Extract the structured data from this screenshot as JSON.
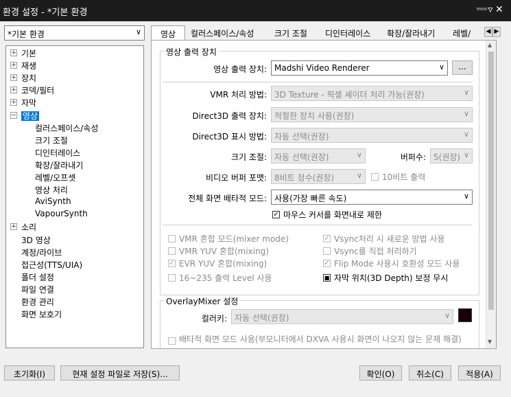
{
  "window": {
    "title": "환경 설정 - *기본 환경",
    "pin_icon": "pin-icon",
    "close_icon": "close-icon"
  },
  "profile_combo": {
    "value": "*기본 환경"
  },
  "tree": [
    {
      "label": "기본",
      "expander": "+"
    },
    {
      "label": "재생",
      "expander": "+"
    },
    {
      "label": "장치",
      "expander": "+"
    },
    {
      "label": "코덱/필터",
      "expander": "+"
    },
    {
      "label": "자막",
      "expander": "+"
    },
    {
      "label": "영상",
      "expander": "−"
    },
    {
      "label": "컬러스페이스/속성"
    },
    {
      "label": "크기 조절"
    },
    {
      "label": "디인터레이스"
    },
    {
      "label": "확장/잘라내기"
    },
    {
      "label": "레벨/오프셋"
    },
    {
      "label": "영상 처리"
    },
    {
      "label": "AviSynth"
    },
    {
      "label": "VapourSynth"
    },
    {
      "label": "소리",
      "expander": "+"
    },
    {
      "label": "3D 영상"
    },
    {
      "label": "계정/라이브"
    },
    {
      "label": "접근성(TTS/UIA)"
    },
    {
      "label": "폴더 설정"
    },
    {
      "label": "파일 연결"
    },
    {
      "label": "환경 관리"
    },
    {
      "label": "화면 보호기"
    }
  ],
  "tabs": [
    "영상",
    "컬러스페이스/속성",
    "크기 조절",
    "디인터레이스",
    "확장/잘라내기",
    "레벨/"
  ],
  "output": {
    "group_title": "영상 출력 장치",
    "device_label": "영상 출력 장치:",
    "device_value": "Madshi Video Renderer",
    "browse_label": "...",
    "vmr_label": "VMR 처리 방법:",
    "vmr_value": "3D Texture - 픽셀 셰이더 처리 가능(권장)",
    "d3d_device_label": "Direct3D 출력 장치:",
    "d3d_device_value": "적절한 장치 사용(권장)",
    "d3d_display_label": "Direct3D 표시 방법:",
    "d3d_display_value": "자동 선택(권장)",
    "resize_label": "크기 조절:",
    "resize_value": "자동 선택(권장)",
    "buffer_label": "버퍼수:",
    "buffer_value": "5(권장)",
    "vbuf_label": "비디오 버퍼 포맷:",
    "vbuf_value": "8비트 정수(권장)",
    "tenbit_label": "10비트 출력",
    "fullscreen_label": "전체 화면 배타적 모드:",
    "fullscreen_value": "사용(가장 빠른 속도)",
    "mouse_label": "마우스 커서를 화면내로 제한"
  },
  "options": {
    "left": [
      {
        "label": "VMR 혼합 모드(mixer mode)",
        "checked": false
      },
      {
        "label": "VMR YUV 혼합(mixing)",
        "checked": false
      },
      {
        "label": "EVR YUV 혼합(mixing)",
        "checked": true
      },
      {
        "label": "16~235 출력 Level 사용",
        "checked": false
      }
    ],
    "right": [
      {
        "label": "Vsync처리 시 새로운 방법 사용",
        "checked": true
      },
      {
        "label": "Vsync를 직접 처리하기",
        "checked": false
      },
      {
        "label": "Flip Mode 사용시 호환성 모드 사용",
        "checked": true
      },
      {
        "label": "자막 위치(3D Depth) 보정 무시",
        "checked": true
      }
    ]
  },
  "overlay": {
    "group_title": "OverlayMixer 설정",
    "colorkey_label": "컬러키:",
    "colorkey_value": "자동 선택(권장)",
    "colorkey_swatch": "#1a0008",
    "exclusive_label": "배타적 화면 모드 사용(부모니터에서 DXVA 사용시 화면이 나오지 않는 문제 해결)"
  },
  "footer": {
    "reset": "초기화(I)",
    "save_file": "현재 설정 파일로 저장(S)...",
    "ok": "확인(O)",
    "cancel": "취소(C)",
    "apply": "적용(A)"
  }
}
